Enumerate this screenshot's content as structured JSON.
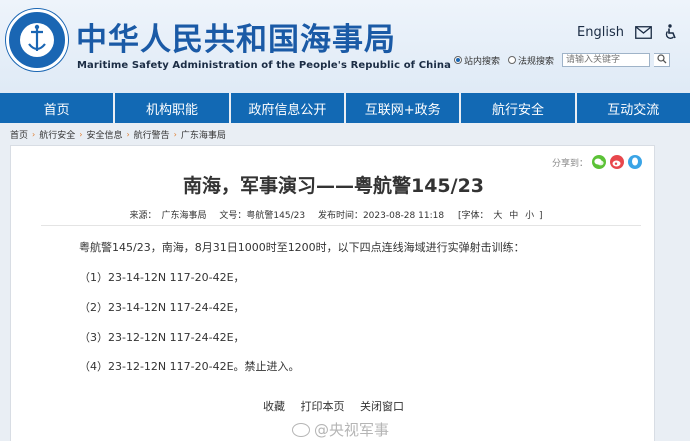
{
  "header": {
    "logo_text_top": "中华人民共和国海事局",
    "logo_text_bottom": "CHINA MSA",
    "title_cn": "中华人民共和国海事局",
    "title_en": "Maritime Safety Administration of the People's Republic of China",
    "lang_link": "English",
    "mail_icon": "mail-icon",
    "accessibility_icon": "accessibility-icon"
  },
  "search": {
    "option_site": "站内搜索",
    "option_law": "法规搜索",
    "placeholder": "请输入关键字",
    "selected": "站内搜索"
  },
  "nav": {
    "items": [
      "首页",
      "机构职能",
      "政府信息公开",
      "互联网+政务",
      "航行安全",
      "互动交流"
    ]
  },
  "breadcrumb": {
    "items": [
      "首页",
      "航行安全",
      "安全信息",
      "航行警告",
      "广东海事局"
    ]
  },
  "article": {
    "share_label": "分享到：",
    "title": "南海，军事演习——粤航警145/23",
    "source_label": "来源：",
    "source": "广东海事局",
    "number_label": "文号：",
    "number": "粤航警145/23",
    "time_label": "发布时间：",
    "time": "2023-08-28 11:18",
    "font_label": "[字体：",
    "font_large": "大",
    "font_medium": "中",
    "font_small": "小",
    "font_close": "]",
    "paragraphs": [
      "粤航警145/23，南海，8月31日1000时至1200时，以下四点连线海域进行实弹射击训练：",
      "（1）23-14-12N  117-20-42E，",
      "（2）23-14-12N  117-24-42E，",
      "（3）23-12-12N  117-24-42E，",
      "（4）23-12-12N  117-20-42E。禁止进入。"
    ],
    "actions": [
      "收藏",
      "打印本页",
      "关闭窗口"
    ]
  },
  "watermark": "@央视军事",
  "colors": {
    "brand_blue": "#1269b4",
    "title_blue": "#1a5aa6",
    "wechat_green": "#5bc236",
    "weibo_red": "#e8474c",
    "qq_blue": "#3aa4e6"
  }
}
